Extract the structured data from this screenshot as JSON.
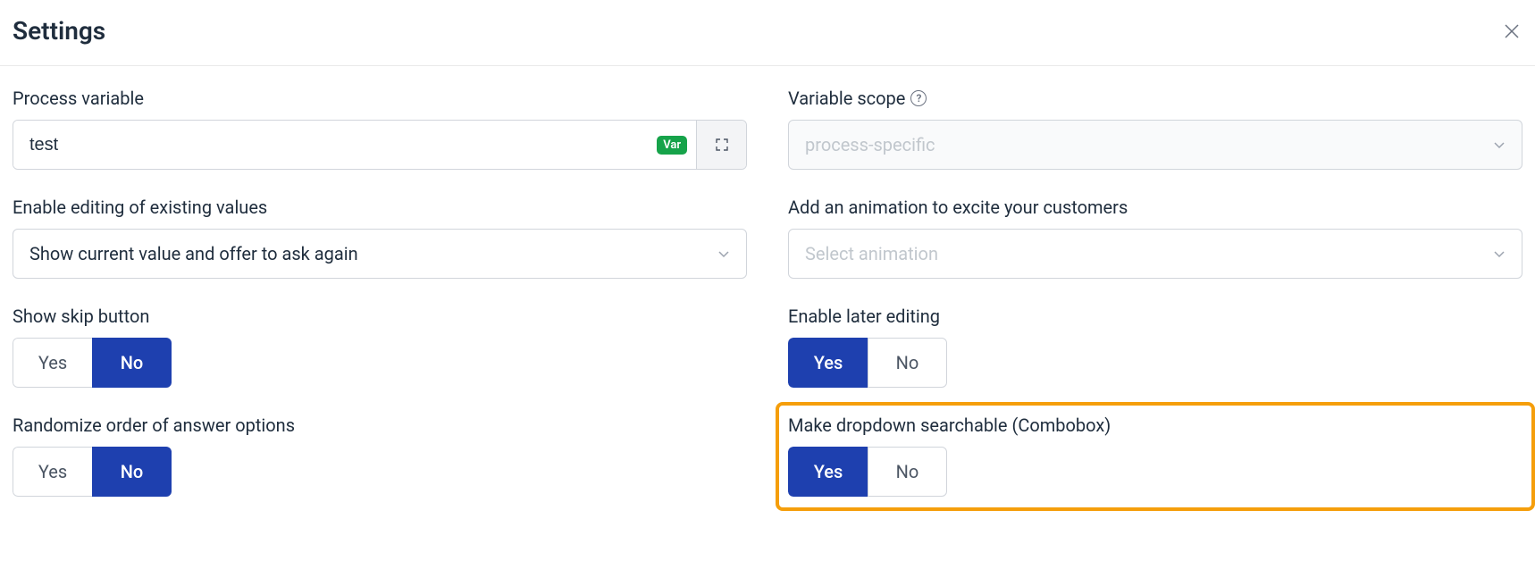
{
  "header": {
    "title": "Settings"
  },
  "left": {
    "process_variable": {
      "label": "Process variable",
      "value": "test",
      "badge": "Var"
    },
    "enable_editing": {
      "label": "Enable editing of existing values",
      "value": "Show current value and offer to ask again"
    },
    "show_skip": {
      "label": "Show skip button",
      "yes": "Yes",
      "no": "No"
    },
    "randomize": {
      "label": "Randomize order of answer options",
      "yes": "Yes",
      "no": "No"
    }
  },
  "right": {
    "variable_scope": {
      "label": "Variable scope",
      "placeholder": "process-specific"
    },
    "animation": {
      "label": "Add an animation to excite your customers",
      "placeholder": "Select animation"
    },
    "enable_later": {
      "label": "Enable later editing",
      "yes": "Yes",
      "no": "No"
    },
    "searchable": {
      "label": "Make dropdown searchable (Combobox)",
      "yes": "Yes",
      "no": "No"
    }
  }
}
